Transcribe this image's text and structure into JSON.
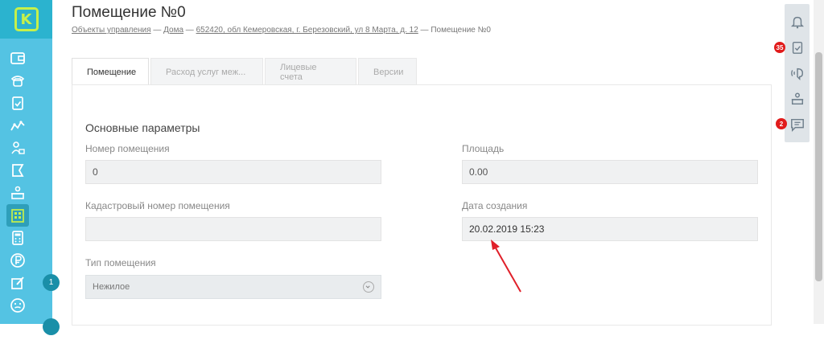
{
  "page": {
    "title": "Помещение №0",
    "breadcrumbs": {
      "item1": "Объекты управления",
      "sep": " — ",
      "item2": "Дома",
      "item3": "652420, обл Кемеровская, г. Березовский, ул 8 Марта, д. 12",
      "current": "Помещение №0"
    }
  },
  "sidebar": {
    "logo": "K",
    "items": [
      {
        "icon": "wallet-icon"
      },
      {
        "icon": "phone-icon"
      },
      {
        "icon": "clipboard-check-icon"
      },
      {
        "icon": "analytics-icon"
      },
      {
        "icon": "people-icon"
      },
      {
        "icon": "flag-icon"
      },
      {
        "icon": "desk-user-icon"
      },
      {
        "icon": "building-icon"
      },
      {
        "icon": "calculator-icon"
      },
      {
        "icon": "ruble-icon"
      },
      {
        "icon": "edit-icon"
      },
      {
        "icon": "smile-icon"
      },
      {
        "icon": "more-icon"
      }
    ],
    "badge_1": "1"
  },
  "tabs": [
    "Помещение",
    "Расход услуг меж...",
    "Лицевые счета",
    "Версии"
  ],
  "form": {
    "section_title": "Основные параметры",
    "room_number_label": "Номер помещения",
    "room_number_value": "0",
    "area_label": "Площадь",
    "area_value": "0.00",
    "cadastral_label": "Кадастровый номер помещения",
    "cadastral_value": "",
    "created_label": "Дата создания",
    "created_value": "20.02.2019 15:23",
    "room_type_label": "Тип помещения",
    "room_type_value": "Нежилое"
  },
  "right_rail": {
    "items": [
      {
        "icon": "bell-icon"
      },
      {
        "icon": "tasks-icon",
        "badge": "35"
      },
      {
        "icon": "call-icon"
      },
      {
        "icon": "operator-icon"
      },
      {
        "icon": "chat-icon",
        "badge": "2"
      }
    ]
  },
  "colors": {
    "sidebar": "#54c3e3",
    "accent_logo": "#c6f04a",
    "badge_red": "#e11b1b",
    "annotation_arrow": "#e0202a"
  }
}
